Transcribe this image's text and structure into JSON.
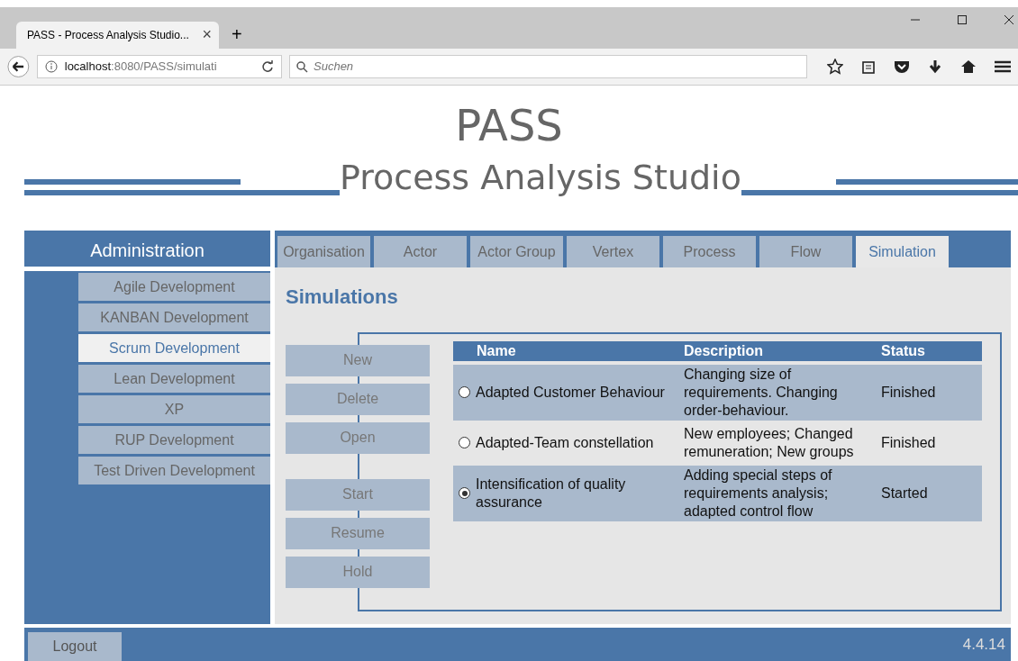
{
  "browser": {
    "tab_title": "PASS - Process Analysis Studio...",
    "tab_close": "×",
    "new_tab": "+",
    "url_host": "localhost",
    "url_path": ":8080/PASS/simulati",
    "search_placeholder": "Suchen"
  },
  "header": {
    "title": "PASS",
    "subtitle": "Process Analysis Studio"
  },
  "sidebar": {
    "title": "Administration",
    "items": [
      {
        "label": "Agile Development",
        "selected": false
      },
      {
        "label": "KANBAN Development",
        "selected": false
      },
      {
        "label": "Scrum Development",
        "selected": true
      },
      {
        "label": "Lean Development",
        "selected": false
      },
      {
        "label": "XP",
        "selected": false
      },
      {
        "label": "RUP Development",
        "selected": false
      },
      {
        "label": "Test Driven Development",
        "selected": false
      }
    ]
  },
  "tabs": [
    {
      "label": "Organisation",
      "selected": false
    },
    {
      "label": "Actor",
      "selected": false
    },
    {
      "label": "Actor Group",
      "selected": false
    },
    {
      "label": "Vertex",
      "selected": false
    },
    {
      "label": "Process",
      "selected": false
    },
    {
      "label": "Flow",
      "selected": false
    },
    {
      "label": "Simulation",
      "selected": true
    }
  ],
  "page_title": "Simulations",
  "button_groups": [
    [
      {
        "label": "New"
      },
      {
        "label": "Delete"
      },
      {
        "label": "Open"
      }
    ],
    [
      {
        "label": "Start"
      },
      {
        "label": "Resume"
      },
      {
        "label": "Hold"
      }
    ]
  ],
  "table": {
    "columns": [
      "Name",
      "Description",
      "Status"
    ],
    "rows": [
      {
        "name": "Adapted Customer Behaviour",
        "description": "Changing size of requirements. Changing order-behaviour.",
        "status": "Finished",
        "selected": false
      },
      {
        "name": "Adapted-Team constellation",
        "description": "New employees; Changed remuneration; New groups",
        "status": "Finished",
        "selected": false
      },
      {
        "name": "Intensification of quality assurance",
        "description": "Adding special steps of requirements analysis; adapted control flow",
        "status": "Started",
        "selected": true
      }
    ]
  },
  "footer": {
    "logout": "Logout",
    "version": "4.4.14"
  }
}
